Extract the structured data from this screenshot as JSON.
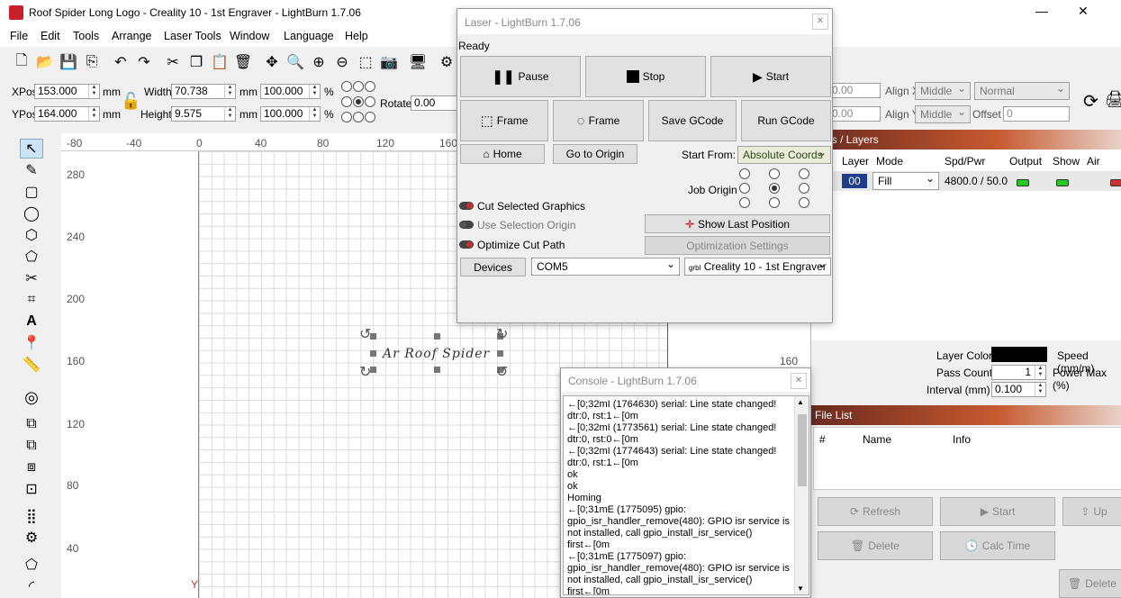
{
  "window": {
    "title": "Roof Spider Long Logo - Creality 10 - 1st Engraver - LightBurn 1.7.06",
    "minimize": "—",
    "close": "✕"
  },
  "menu": [
    "File",
    "Edit",
    "Tools",
    "Arrange",
    "Laser Tools",
    "Window",
    "Language",
    "Help"
  ],
  "position": {
    "xpos_label": "XPos",
    "xpos": "153.000",
    "ypos_label": "YPos",
    "ypos": "164.000",
    "unit": "mm",
    "width_label": "Width",
    "width": "70.738",
    "height_label": "Height",
    "height": "9.575",
    "scale_w": "100.000",
    "scale_h": "100.000",
    "percent": "%",
    "rotate_label": "Rotate",
    "rotate": "0.00"
  },
  "rightbar": {
    "val1": "0.00",
    "val2": "0.00",
    "align_x_label": "Align X",
    "align_x": "Middle",
    "align_y_label": "Align Y",
    "align_y": "Middle",
    "normal": "Normal",
    "offset_label": "Offset",
    "offset": "0"
  },
  "ruler": {
    "top": [
      "-80",
      "-40",
      "0",
      "40",
      "80",
      "120",
      "160"
    ],
    "left": [
      "280",
      "240",
      "200",
      "160",
      "120",
      "80",
      "40"
    ],
    "right_tick": "160",
    "y_label": "Y"
  },
  "canvas": {
    "text": "Ar Roof Spider"
  },
  "laser": {
    "title": "Laser - LightBurn 1.7.06",
    "status": "Ready",
    "pause": "Pause",
    "stop": "Stop",
    "start": "Start",
    "frame1": "Frame",
    "frame2": "Frame",
    "save_gcode": "Save GCode",
    "run_gcode": "Run GCode",
    "home": "Home",
    "go_origin": "Go to Origin",
    "start_from_label": "Start From:",
    "start_from": "Absolute Coords",
    "job_origin": "Job Origin",
    "cut_selected": "Cut Selected Graphics",
    "use_selection_origin": "Use Selection Origin",
    "optimize": "Optimize Cut Path",
    "show_last": "Show Last Position",
    "opt_settings": "Optimization Settings",
    "devices": "Devices",
    "port": "COM5",
    "device": "Creality 10 - 1st Engraver",
    "device_prefix": "grbl"
  },
  "cuts": {
    "title": "Cuts / Layers",
    "headers": [
      "Layer",
      "Mode",
      "Spd/Pwr",
      "Output",
      "Show",
      "Air"
    ],
    "row": {
      "layer": "00",
      "mode": "Fill",
      "spdpwr": "4800.0 / 50.0"
    },
    "layer_color": "Layer Color",
    "pass_count": "Pass Count",
    "pass_value": "1",
    "interval": "Interval (mm)",
    "interval_value": "0.100",
    "speed": "Speed (mm/m)",
    "power_max": "Power Max (%)"
  },
  "filelist": {
    "title": "File List",
    "headers": [
      "#",
      "Name",
      "Info"
    ],
    "refresh": "Refresh",
    "start": "Start",
    "up": "Up",
    "delete": "Delete",
    "calc": "Calc Time",
    "delete2": "Delete"
  },
  "console": {
    "title": "Console - LightBurn 1.7.06",
    "text": "←[0;32mI (1764630) serial: Line state changed!\ndtr:0, rst:1←[0m\n←[0;32mI (1773561) serial: Line state changed!\ndtr:0, rst:0←[0m\n←[0;32mI (1774643) serial: Line state changed!\ndtr:0, rst:1←[0m\nok\nok\nHoming\n←[0;31mE (1775095) gpio:\ngpio_isr_handler_remove(480): GPIO isr service is\nnot installed, call gpio_install_isr_service()\nfirst←[0m\n←[0;31mE (1775097) gpio:\ngpio_isr_handler_remove(480): GPIO isr service is\nnot installed, call gpio_install_isr_service()\nfirst←[0m"
  }
}
